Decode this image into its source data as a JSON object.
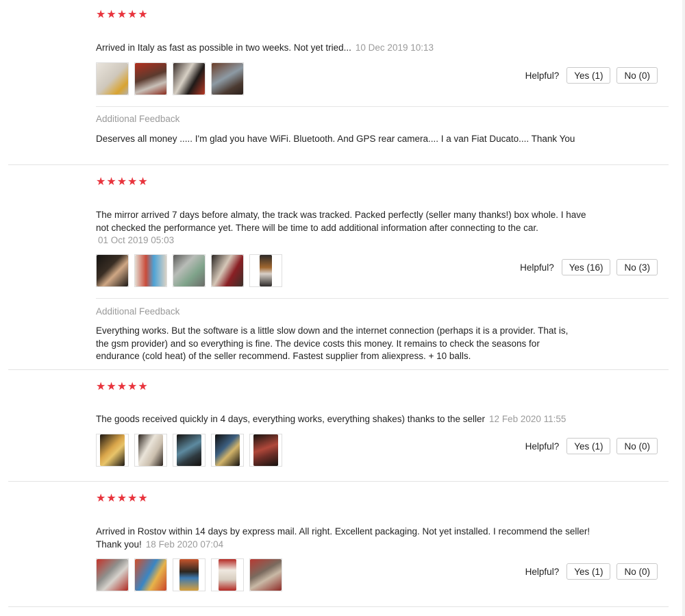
{
  "reviews": [
    {
      "stars": "★★★★★",
      "text": "Arrived in Italy as fast as possible in two weeks. Not yet tried...",
      "date": "10 Dec 2019 10:13",
      "photos": [
        "photo-1",
        "photo-2",
        "photo-3",
        "photo-4"
      ],
      "helpful_label": "Helpful?",
      "yes_label": "Yes (1)",
      "no_label": "No (0)",
      "feedback_title": "Additional Feedback",
      "feedback_text": "Deserves all money ..... I'm glad you have WiFi. Bluetooth. And GPS rear camera.... I a van Fiat Ducato.... Thank You"
    },
    {
      "stars": "★★★★★",
      "text": "The mirror arrived 7 days before almaty, the track was tracked. Packed perfectly (seller many thanks!) box whole. I have not checked the performance yet. There will be time to add additional information after connecting to the car.",
      "date": "01 Oct 2019 05:03",
      "photos": [
        "photo-1",
        "photo-2",
        "photo-3",
        "photo-4",
        "photo-5"
      ],
      "helpful_label": "Helpful?",
      "yes_label": "Yes (16)",
      "no_label": "No (3)",
      "feedback_title": "Additional Feedback",
      "feedback_text": "Everything works. But the software is a little slow down and the internet connection (perhaps it is a provider. That is, the gsm provider) and so everything is fine. The device costs this money. It remains to check the seasons for endurance (cold heat) of the seller recommend. Fastest supplier from aliexpress. + 10 balls."
    },
    {
      "stars": "★★★★★",
      "text": "The goods received quickly in 4 days, everything works, everything shakes) thanks to the seller",
      "date": "12 Feb 2020 11:55",
      "photos": [
        "photo-1",
        "photo-2",
        "photo-3",
        "photo-4",
        "photo-5"
      ],
      "helpful_label": "Helpful?",
      "yes_label": "Yes (1)",
      "no_label": "No (0)"
    },
    {
      "stars": "★★★★★",
      "text": "Arrived in Rostov within 14 days by express mail. All right. Excellent packaging. Not yet installed. I recommend the seller! Thank you!",
      "date": "18 Feb 2020 07:04",
      "photos": [
        "photo-1",
        "photo-2",
        "photo-3",
        "photo-4",
        "photo-5"
      ],
      "helpful_label": "Helpful?",
      "yes_label": "Yes (1)",
      "no_label": "No (0)"
    }
  ],
  "colors": {
    "star": "#e8343d",
    "date": "#9a9a9a",
    "divider": "#e3e3e3"
  }
}
